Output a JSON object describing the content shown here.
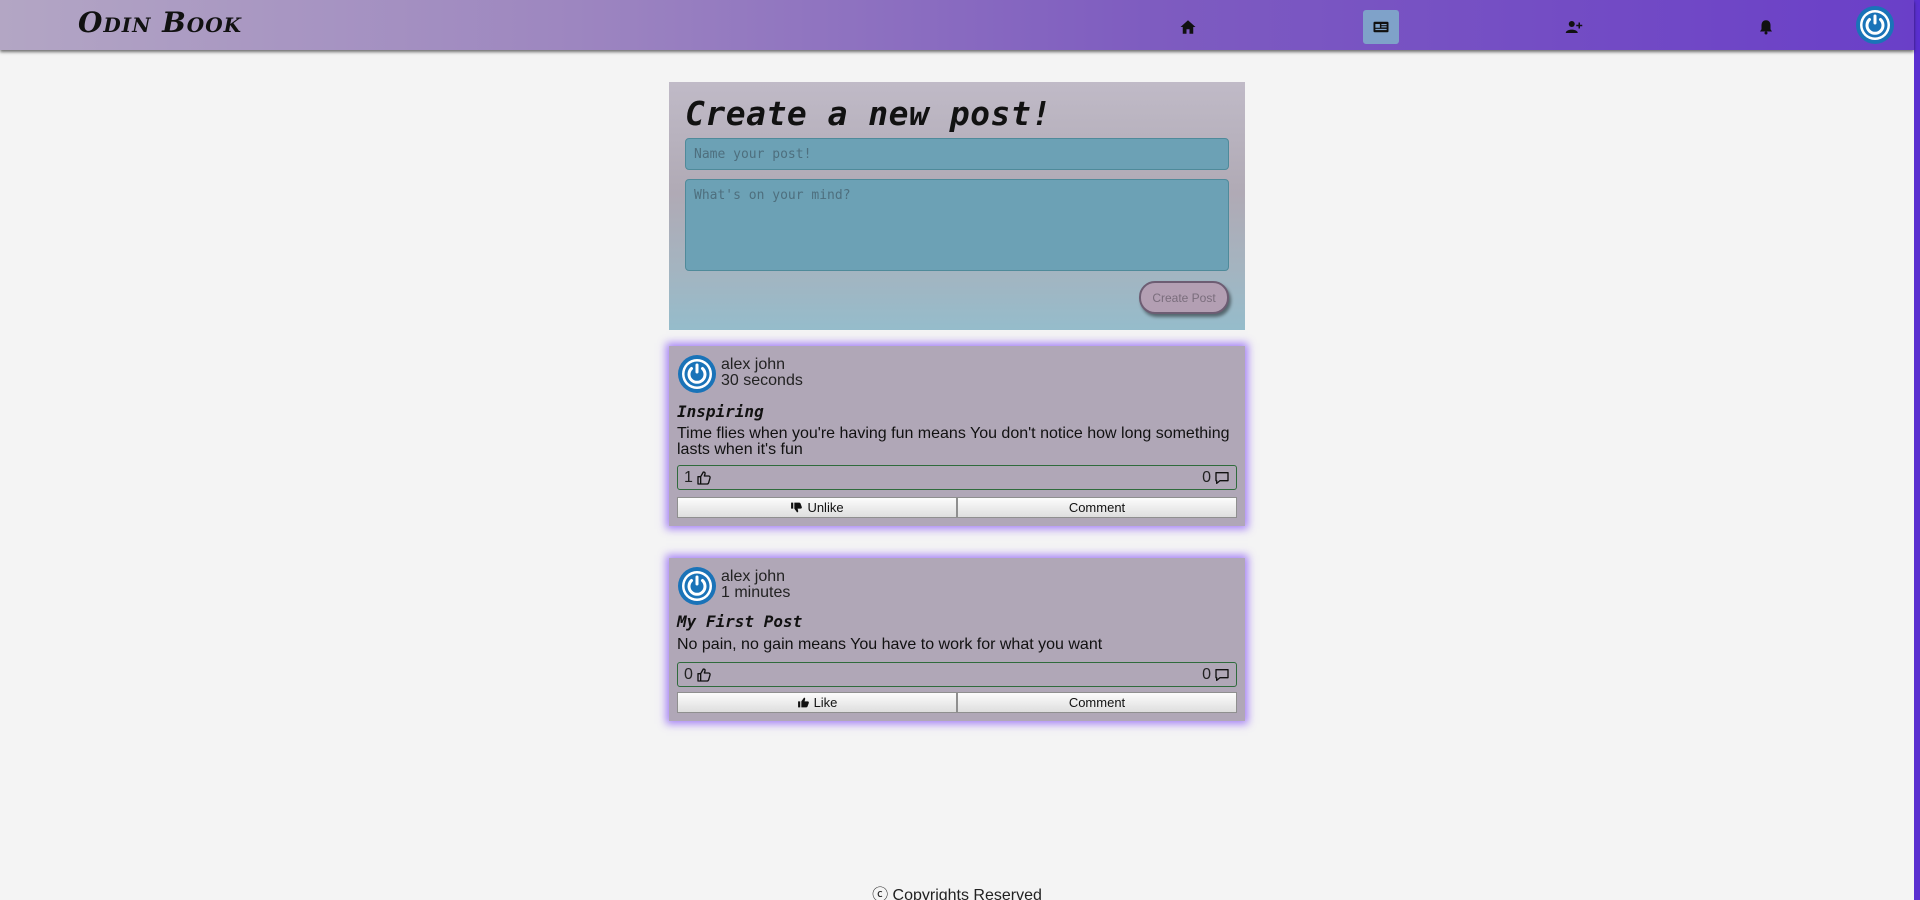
{
  "header": {
    "logo": "Odin Book",
    "nav": [
      {
        "icon": "home-icon"
      },
      {
        "icon": "news-card-icon",
        "active": true
      },
      {
        "icon": "add-friend-icon"
      },
      {
        "icon": "bell-icon"
      }
    ],
    "avatar_icon": "power-avatar-icon"
  },
  "create_post": {
    "heading": "Create a new post!",
    "title_placeholder": "Name your post!",
    "body_placeholder": "What's on your mind?",
    "submit_label": "Create Post"
  },
  "posts": [
    {
      "author": "alex john",
      "time": "30 seconds",
      "title": "Inspiring",
      "body": "Time flies when you're having fun means You don't notice how long something lasts when it's fun",
      "likes": "1",
      "comments": "0",
      "like_action": "Unlike",
      "comment_action": "Comment"
    },
    {
      "author": "alex john",
      "time": "1 minutes",
      "title": "My First Post",
      "body": "No pain, no gain means You have to work for what you want",
      "likes": "0",
      "comments": "0",
      "like_action": "Like",
      "comment_action": "Comment"
    }
  ],
  "footer": {
    "text": "ⓒ Copyrights Reserved"
  },
  "colors": {
    "accent": "#6a3fc8",
    "card": "#b0a7b7",
    "input": "#6ca1b5"
  }
}
